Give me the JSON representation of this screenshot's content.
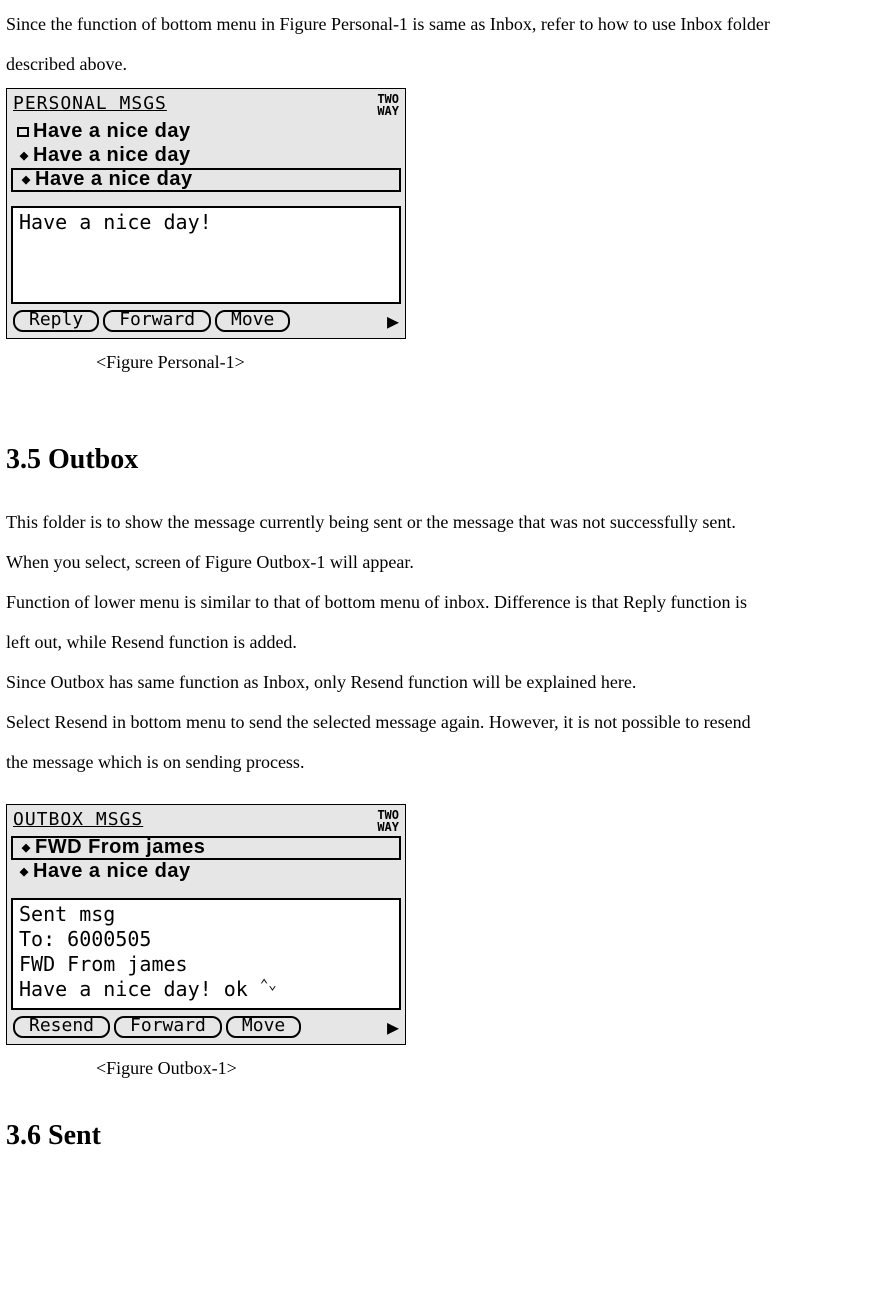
{
  "intro": {
    "line1": "Since the function of bottom menu in Figure Personal-1 is same as Inbox, refer to how to use Inbox folder",
    "line2": "described above."
  },
  "personal_figure": {
    "title": "PERSONAL MSGS",
    "badge_l1": "TWO",
    "badge_l2": "WAY",
    "rows": [
      {
        "icon": "unread",
        "label": "Have a nice day"
      },
      {
        "icon": "diamond",
        "label": "Have a nice day"
      },
      {
        "icon": "diamond",
        "label": "Have a nice day"
      }
    ],
    "preview": "Have a nice day!",
    "buttons": [
      "Reply",
      "Forward",
      "Move"
    ],
    "caption": "<Figure Personal-1>"
  },
  "outbox_heading": "3.5 Outbox",
  "outbox_text": {
    "l1": "This folder is to show the message currently being sent or the message that was not successfully sent.",
    "l2": "When you select, screen of Figure Outbox-1 will appear.",
    "l3": "Function of lower menu is similar to that of bottom menu of inbox. Difference is that Reply function is",
    "l4": "left out, while Resend function is added.",
    "l5": "Since Outbox has same function as Inbox, only Resend function will be explained here.",
    "l6": "Select Resend in bottom menu to send the selected message again.    However, it is not possible to resend",
    "l7": "the message which is on sending process."
  },
  "outbox_figure": {
    "title": "OUTBOX MSGS",
    "badge_l1": "TWO",
    "badge_l2": "WAY",
    "rows": [
      {
        "icon": "diamond",
        "label": "FWD From james"
      },
      {
        "icon": "diamond",
        "label": "Have a nice day"
      }
    ],
    "preview_l1": "Sent msg",
    "preview_l2": "To: 6000505",
    "preview_l3": "FWD From james",
    "preview_l4": "Have a nice day! ok",
    "buttons": [
      "Resend",
      "Forward",
      "Move"
    ],
    "caption": "<Figure Outbox-1>"
  },
  "sent_heading": "3.6 Sent"
}
